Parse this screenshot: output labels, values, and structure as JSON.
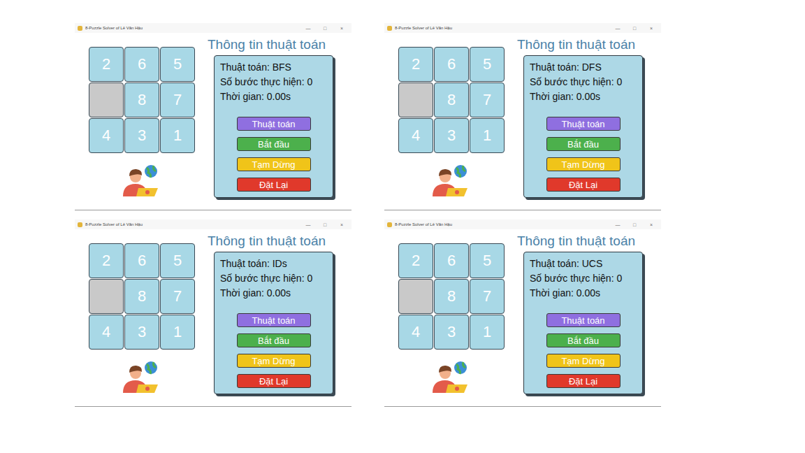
{
  "windows": [
    {
      "title": "8-Puzzle Solver of Lê Văn Hậu",
      "controls": [
        "—",
        "□",
        "×"
      ],
      "tiles": [
        {
          "label": "2",
          "empty": false
        },
        {
          "label": "6",
          "empty": false
        },
        {
          "label": "5",
          "empty": false
        },
        {
          "label": "",
          "empty": true
        },
        {
          "label": "8",
          "empty": false
        },
        {
          "label": "7",
          "empty": false
        },
        {
          "label": "4",
          "empty": false
        },
        {
          "label": "3",
          "empty": false
        },
        {
          "label": "1",
          "empty": false
        }
      ],
      "heading": "Thông tin thuật toán",
      "info": [
        "Thuật toán: BFS",
        "Số bước thực hiện: 0",
        "Thời gian: 0.00s"
      ],
      "buttons": [
        {
          "label": "Thuật toán",
          "color": "#8f6fe0"
        },
        {
          "label": "Bắt đầu",
          "color": "#4cb04c"
        },
        {
          "label": "Tạm Dừng",
          "color": "#f0c419"
        },
        {
          "label": "Đặt Lại",
          "color": "#e0392b"
        }
      ]
    },
    {
      "title": "8-Puzzle Solver of Lê Văn Hậu",
      "controls": [
        "—",
        "□",
        "×"
      ],
      "tiles": [
        {
          "label": "2",
          "empty": false
        },
        {
          "label": "6",
          "empty": false
        },
        {
          "label": "5",
          "empty": false
        },
        {
          "label": "",
          "empty": true
        },
        {
          "label": "8",
          "empty": false
        },
        {
          "label": "7",
          "empty": false
        },
        {
          "label": "4",
          "empty": false
        },
        {
          "label": "3",
          "empty": false
        },
        {
          "label": "1",
          "empty": false
        }
      ],
      "heading": "Thông tin thuật toán",
      "info": [
        "Thuật toán: DFS",
        "Số bước thực hiện: 0",
        "Thời gian: 0.00s"
      ],
      "buttons": [
        {
          "label": "Thuật toán",
          "color": "#8f6fe0"
        },
        {
          "label": "Bắt đầu",
          "color": "#4cb04c"
        },
        {
          "label": "Tạm Dừng",
          "color": "#f0c419"
        },
        {
          "label": "Đặt Lại",
          "color": "#e0392b"
        }
      ]
    },
    {
      "title": "8-Puzzle Solver of Lê Văn Hậu",
      "controls": [
        "—",
        "□",
        "×"
      ],
      "tiles": [
        {
          "label": "2",
          "empty": false
        },
        {
          "label": "6",
          "empty": false
        },
        {
          "label": "5",
          "empty": false
        },
        {
          "label": "",
          "empty": true
        },
        {
          "label": "8",
          "empty": false
        },
        {
          "label": "7",
          "empty": false
        },
        {
          "label": "4",
          "empty": false
        },
        {
          "label": "3",
          "empty": false
        },
        {
          "label": "1",
          "empty": false
        }
      ],
      "heading": "Thông tin thuật toán",
      "info": [
        "Thuật toán: IDs",
        "Số bước thực hiện: 0",
        "Thời gian: 0.00s"
      ],
      "buttons": [
        {
          "label": "Thuật toán",
          "color": "#8f6fe0"
        },
        {
          "label": "Bắt đầu",
          "color": "#4cb04c"
        },
        {
          "label": "Tạm Dừng",
          "color": "#f0c419"
        },
        {
          "label": "Đặt Lại",
          "color": "#e0392b"
        }
      ]
    },
    {
      "title": "8-Puzzle Solver of Lê Văn Hậu",
      "controls": [
        "—",
        "□",
        "×"
      ],
      "tiles": [
        {
          "label": "2",
          "empty": false
        },
        {
          "label": "6",
          "empty": false
        },
        {
          "label": "5",
          "empty": false
        },
        {
          "label": "",
          "empty": true
        },
        {
          "label": "8",
          "empty": false
        },
        {
          "label": "7",
          "empty": false
        },
        {
          "label": "4",
          "empty": false
        },
        {
          "label": "3",
          "empty": false
        },
        {
          "label": "1",
          "empty": false
        }
      ],
      "heading": "Thông tin thuật toán",
      "info": [
        "Thuật toán: UCS",
        "Số bước thực hiện: 0",
        "Thời gian: 0.00s"
      ],
      "buttons": [
        {
          "label": "Thuật toán",
          "color": "#8f6fe0"
        },
        {
          "label": "Bắt đầu",
          "color": "#4cb04c"
        },
        {
          "label": "Tạm Dừng",
          "color": "#f0c419"
        },
        {
          "label": "Đặt Lại",
          "color": "#e0392b"
        }
      ]
    }
  ]
}
